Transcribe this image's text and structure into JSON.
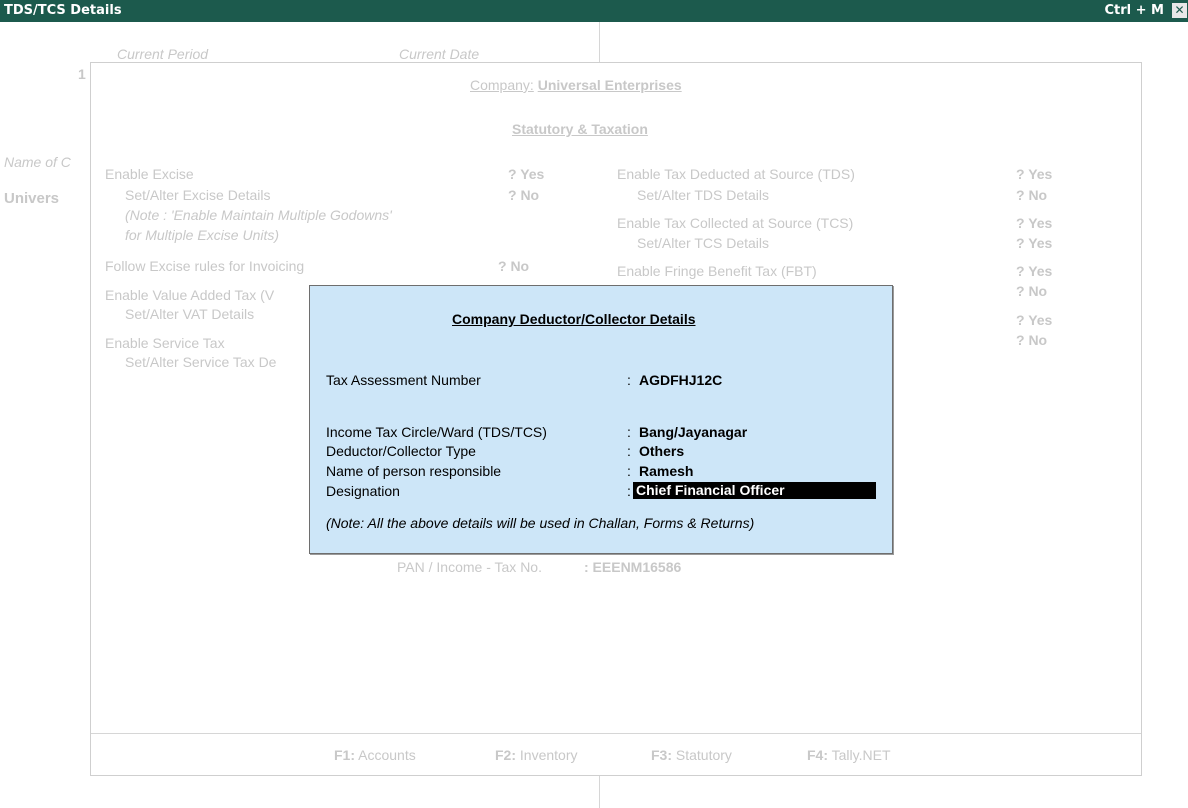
{
  "window": {
    "title": "TDS/TCS Details",
    "shortcut": "Ctrl + M",
    "close_glyph": "✕"
  },
  "background_left": {
    "current_period": "Current Period",
    "current_date": "Current Date",
    "period_value_partial": "1",
    "name_of_partial": "Name of C",
    "company_partial": "Univers"
  },
  "panel": {
    "company_label": "Company:",
    "company_name": "Universal Enterprises",
    "section_title": "Statutory & Taxation",
    "left_rows": [
      {
        "label": "Enable Excise",
        "value": "? Yes"
      },
      {
        "label": "Set/Alter Excise Details",
        "value": "? No"
      },
      {
        "label": "(Note : 'Enable Maintain Multiple Godowns'"
      },
      {
        "label": "for Multiple Excise Units)"
      },
      {
        "label": "Follow Excise rules for Invoicing",
        "value": "? No"
      },
      {
        "label": "Enable Value Added Tax (V"
      },
      {
        "label": "Set/Alter VAT Details"
      },
      {
        "label": "Enable Service Tax"
      },
      {
        "label": "Set/Alter Service Tax De"
      }
    ],
    "right_rows": [
      {
        "label": "Enable Tax Deducted at Source (TDS)",
        "value": "? Yes"
      },
      {
        "label": "Set/Alter TDS Details",
        "value": "? No"
      },
      {
        "label": "Enable Tax Collected at Source (TCS)",
        "value": "? Yes"
      },
      {
        "label": "Set/Alter TCS Details",
        "value": "? Yes"
      },
      {
        "label": "Enable Fringe Benefit Tax (FBT)",
        "value": "? Yes"
      },
      {
        "value": "? No"
      },
      {
        "value": "? Yes"
      },
      {
        "value": "? No"
      }
    ],
    "pan_label": "PAN / Income - Tax No.",
    "pan_value": ": EEENM16586",
    "footer": [
      {
        "key": "F1:",
        "label": "Accounts"
      },
      {
        "key": "F2:",
        "label": "Inventory"
      },
      {
        "key": "F3:",
        "label": "Statutory"
      },
      {
        "key": "F4:",
        "label": "Tally.NET"
      }
    ]
  },
  "dialog": {
    "title": "Company Deductor/Collector Details",
    "fields": [
      {
        "label": "Tax Assessment Number",
        "sep": ":",
        "value": "AGDFHJ12C"
      },
      {
        "label": "Income Tax Circle/Ward (TDS/TCS)",
        "sep": ":",
        "value": "Bang/Jayanagar"
      },
      {
        "label": "Deductor/Collector Type",
        "sep": ":",
        "value": "Others"
      },
      {
        "label": "Name of person responsible",
        "sep": ":",
        "value": "Ramesh"
      },
      {
        "label": "Designation",
        "sep": ":",
        "value": "Chief Financial Officer"
      }
    ],
    "note": "(Note: All the above details will be used in Challan, Forms & Returns)"
  }
}
